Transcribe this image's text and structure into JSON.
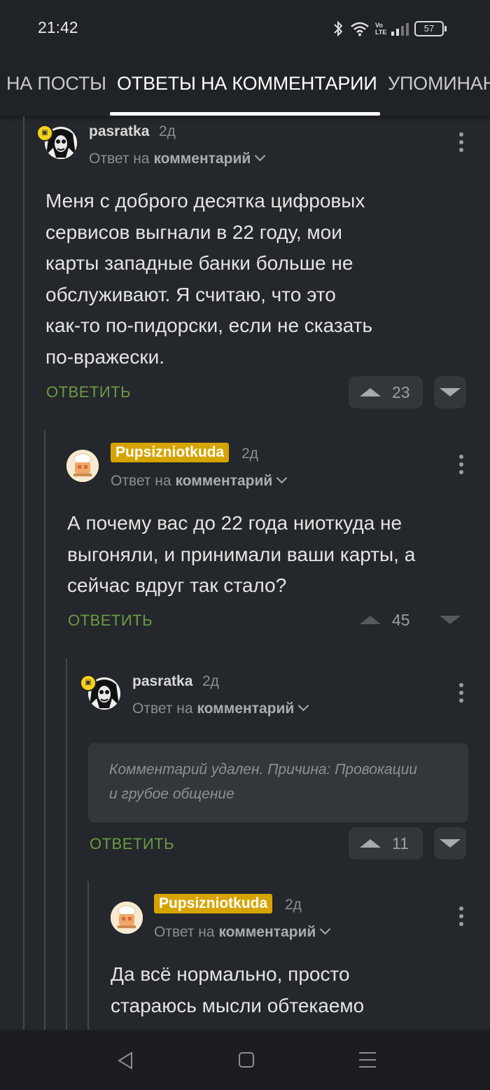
{
  "status_bar": {
    "time": "21:42",
    "icons": [
      "bluetooth-icon",
      "wifi-icon",
      "volte-icon",
      "signal-icon"
    ],
    "network_label": "Vo LTE",
    "battery_level": "57"
  },
  "tabs": [
    {
      "label": "НА ПОСТЫ",
      "active": false
    },
    {
      "label": "ОТВЕТЫ НА КОММЕНТАРИИ",
      "active": true
    },
    {
      "label": "УПОМИНАН",
      "active": false
    }
  ],
  "common": {
    "reply_prefix": "Ответ на",
    "reply_target": "комментарий",
    "reply_button": "ОТВЕТИТЬ"
  },
  "comments": [
    {
      "author": "pasratka",
      "highlighted": false,
      "time": "2д",
      "text": [
        "Меня с доброго десятка цифровых",
        "сервисов выгнали в 22 году, мои",
        "карты западные банки больше не",
        "обслуживают. Я считаю, что это",
        "как-то по-пидорски, если не сказать",
        "по-вражески."
      ],
      "score": "23"
    },
    {
      "author": "Pupsizniotkuda",
      "highlighted": true,
      "time": "2д",
      "text": [
        "А почему вас до 22 года ниоткуда не",
        "выгоняли, и принимали ваши карты, а",
        "сейчас вдруг так стало?"
      ],
      "score": "45"
    },
    {
      "author": "pasratka",
      "highlighted": false,
      "time": "2д",
      "deleted_text": [
        "Комментарий удален. Причина: Провокации",
        "и грубое общение"
      ],
      "score": "11"
    },
    {
      "author": "Pupsizniotkuda",
      "highlighted": true,
      "time": "2д",
      "text": [
        "Да всё нормально, просто",
        "стараюсь мысли обтекаемо"
      ]
    }
  ],
  "colors": {
    "background": "#24272b",
    "bar": "#1f2226",
    "reply_green": "#6c9a45",
    "highlight_gold": "#d6a400",
    "badge_yellow": "#f6d21b"
  }
}
